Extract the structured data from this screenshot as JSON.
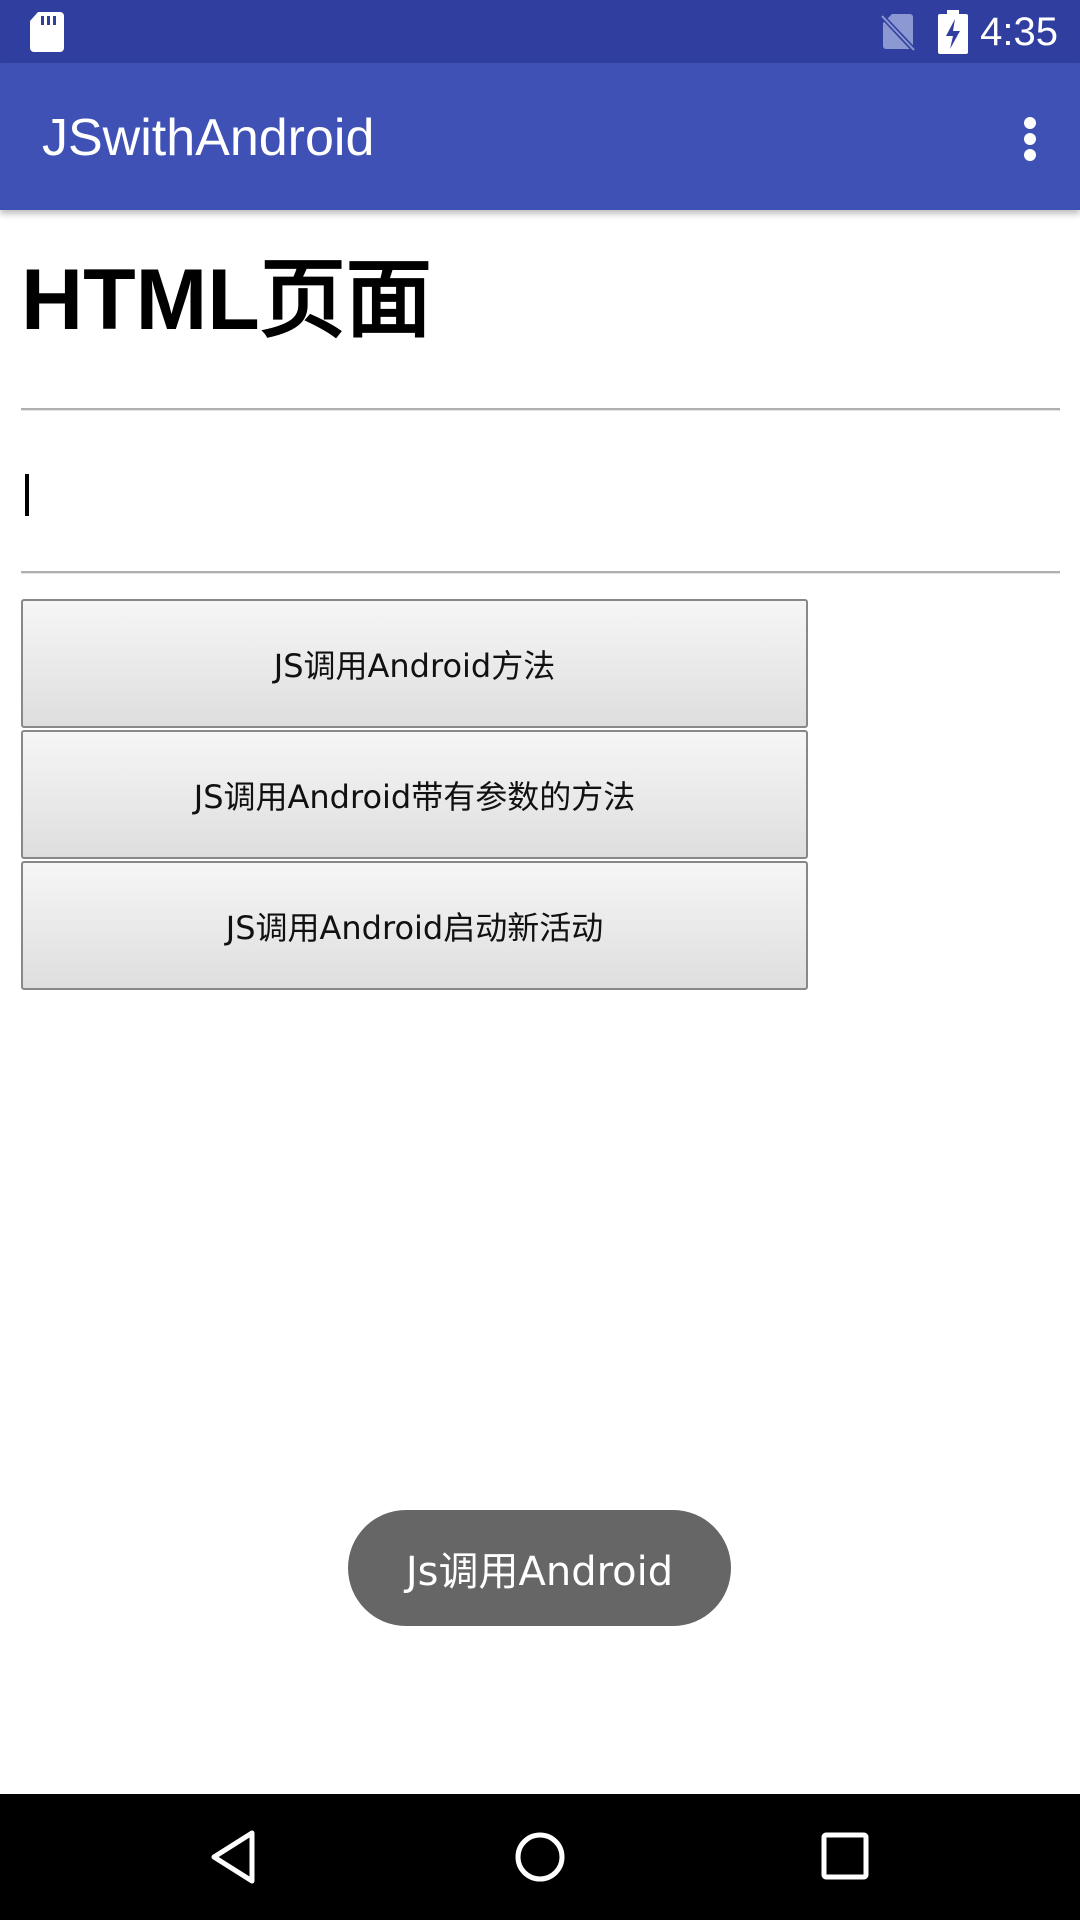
{
  "status_bar": {
    "time": "4:35",
    "icons": [
      "sd-card-icon",
      "no-sim-icon",
      "battery-charging-icon"
    ],
    "color": "#303F9F"
  },
  "app_bar": {
    "title": "JSwithAndroid",
    "menu_icon": "overflow-menu-icon",
    "color": "#3F51B5"
  },
  "webview": {
    "heading": "HTML页面",
    "text_area_value": "",
    "buttons": [
      {
        "label": "JS调用Android方法"
      },
      {
        "label": "JS调用Android带有参数的方法"
      },
      {
        "label": "JS调用Android启动新活动"
      }
    ]
  },
  "toast": {
    "message": "Js调用Android"
  },
  "nav_bar": {
    "icons": [
      "back-icon",
      "home-icon",
      "recents-icon"
    ]
  }
}
